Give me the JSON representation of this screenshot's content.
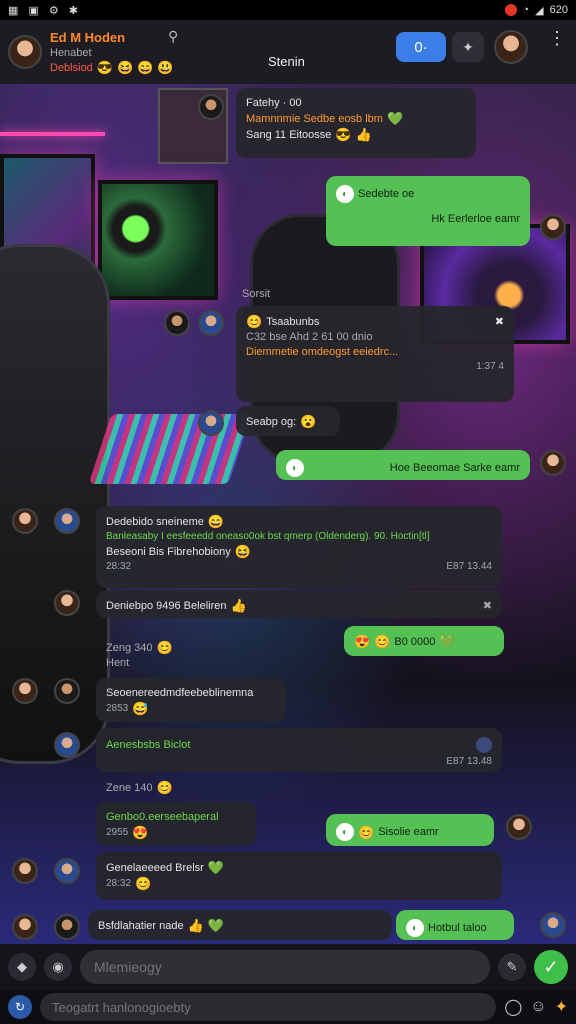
{
  "status_bar": {
    "icons_left": [
      "apps-icon",
      "gallery-icon",
      "settings-icon",
      "bluetooth-icon"
    ],
    "battery_text": "620"
  },
  "header": {
    "group_name": "Ed M Hoden",
    "group_sub": "Henabet",
    "group_tag": "Deblsiod",
    "title": "Stenin",
    "call_label": "0·"
  },
  "messages": [
    {
      "side": "in",
      "lines": [
        "Fatehy · 00",
        "Mamnnmie Sedbe eosb lbm",
        "Sang 11 Eitoosse"
      ]
    },
    {
      "side": "out",
      "lines": [
        "Sedebte oe",
        "Hk Eerlerloe   eamr"
      ]
    },
    {
      "side": "label",
      "text": "Sorsit"
    },
    {
      "side": "in",
      "lines": [
        "Tsaabunbs",
        "C32 bse Ahd 2 61 00 dnio",
        "Diemmetie omdeogst eeiedrc...",
        "1:37 4"
      ]
    },
    {
      "side": "in",
      "lines": [
        "Seabp og:"
      ]
    },
    {
      "side": "out",
      "lines": [
        "Hoe Beeomae  Sarke   eamr"
      ]
    },
    {
      "side": "in",
      "lines": [
        "Dedebido sneineme",
        "Banleasaby I eesfeeedd oneaso0ok bst qmerp (Oldenderg). 90. Hoctin[tl]",
        "Beseoni Bis Fibrehobiony",
        "28:32",
        "E87 13.44"
      ]
    },
    {
      "side": "in",
      "lines": [
        "Deniebpo 9496 Beleliren"
      ]
    },
    {
      "side": "out",
      "lines": [
        "B0 0000"
      ]
    },
    {
      "side": "in",
      "lines": [
        "Zeng  340",
        "Hent"
      ]
    },
    {
      "side": "in",
      "lines": [
        "Seoenereedmdfeebeblinemna",
        "2853"
      ]
    },
    {
      "side": "in",
      "lines": [
        "Aenesbsbs Biclot",
        "E87 13.48"
      ]
    },
    {
      "side": "in",
      "lines": [
        "Zene  140"
      ]
    },
    {
      "side": "in",
      "lines": [
        "Genbo0.eerseebaperal",
        "2955"
      ]
    },
    {
      "side": "out",
      "lines": [
        "Sisolie   eamr"
      ]
    },
    {
      "side": "in",
      "lines": [
        "Genelaeeeed Brelsr",
        "28:32"
      ]
    },
    {
      "side": "in",
      "lines": [
        "Bsfdlahatier nade"
      ]
    },
    {
      "side": "out",
      "lines": [
        "Hotbul taloo"
      ]
    }
  ],
  "compose": {
    "placeholder": "Mlemieogy"
  },
  "compose2": {
    "placeholder": "Teogatrt hanlonogioebty"
  }
}
